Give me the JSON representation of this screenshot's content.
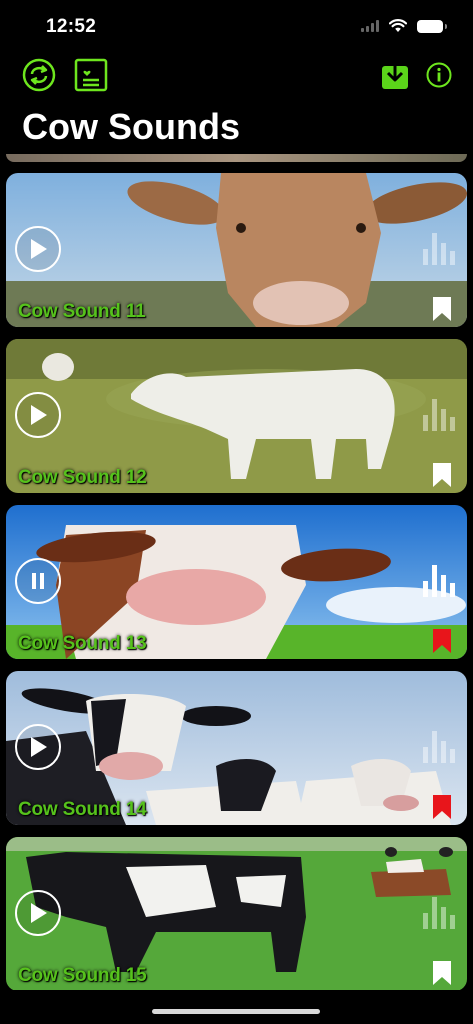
{
  "status": {
    "time": "12:52"
  },
  "header": {
    "title": "Cow Sounds"
  },
  "colors": {
    "accent": "#6ee61e",
    "title_green": "#56c21c",
    "bookmark_active": "#e8151b",
    "bookmark_inactive": "#ffffff"
  },
  "toolbar_icons": [
    "repeat-icon",
    "favorites-list-icon",
    "download-icon",
    "info-icon"
  ],
  "sounds": [
    {
      "title": "Cow Sound 11",
      "state": "stopped",
      "bookmarked": false
    },
    {
      "title": "Cow Sound 12",
      "state": "stopped",
      "bookmarked": false
    },
    {
      "title": "Cow Sound 13",
      "state": "playing",
      "bookmarked": true
    },
    {
      "title": "Cow Sound 14",
      "state": "stopped",
      "bookmarked": true
    },
    {
      "title": "Cow Sound 15",
      "state": "stopped",
      "bookmarked": false
    }
  ]
}
